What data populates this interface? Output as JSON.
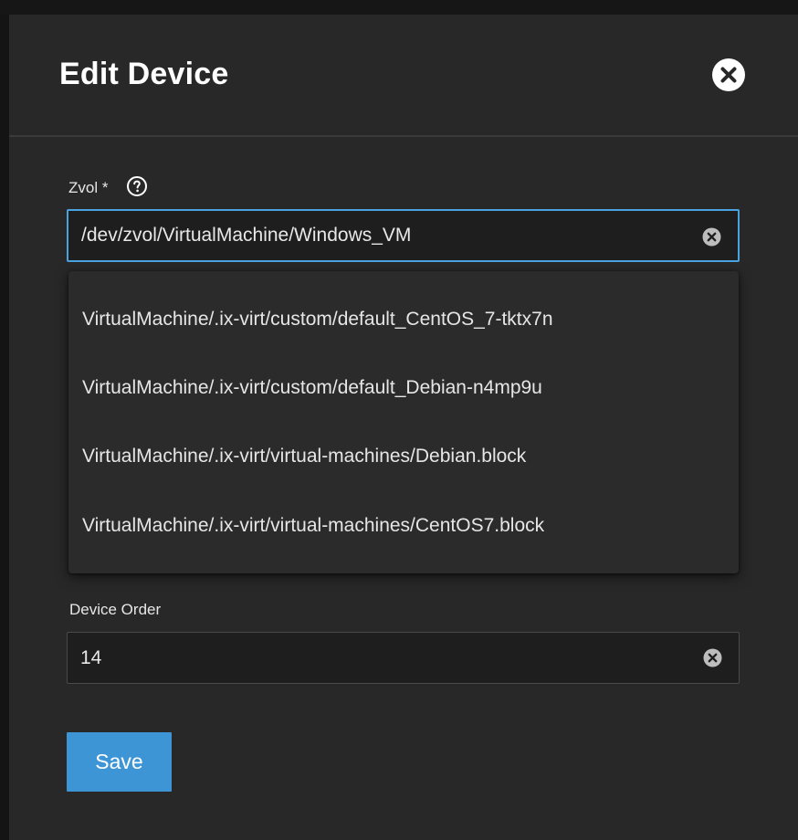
{
  "dialog": {
    "title": "Edit Device"
  },
  "zvol": {
    "label": "Zvol *",
    "value": "/dev/zvol/VirtualMachine/Windows_VM",
    "options": [
      "VirtualMachine/.ix-virt/custom/default_CentOS_7-tktx7n",
      "VirtualMachine/.ix-virt/custom/default_Debian-n4mp9u",
      "VirtualMachine/.ix-virt/virtual-machines/Debian.block",
      "VirtualMachine/.ix-virt/virtual-machines/CentOS7.block"
    ]
  },
  "device_order": {
    "label": "Device Order",
    "value": "14"
  },
  "actions": {
    "save_label": "Save"
  },
  "colors": {
    "accent": "#3d95d6",
    "focus_border": "#4aa3df",
    "dialog_bg": "#282828"
  },
  "icons": {
    "close": "close-circle-icon",
    "help": "help-circle-icon",
    "clear": "clear-circle-icon"
  }
}
